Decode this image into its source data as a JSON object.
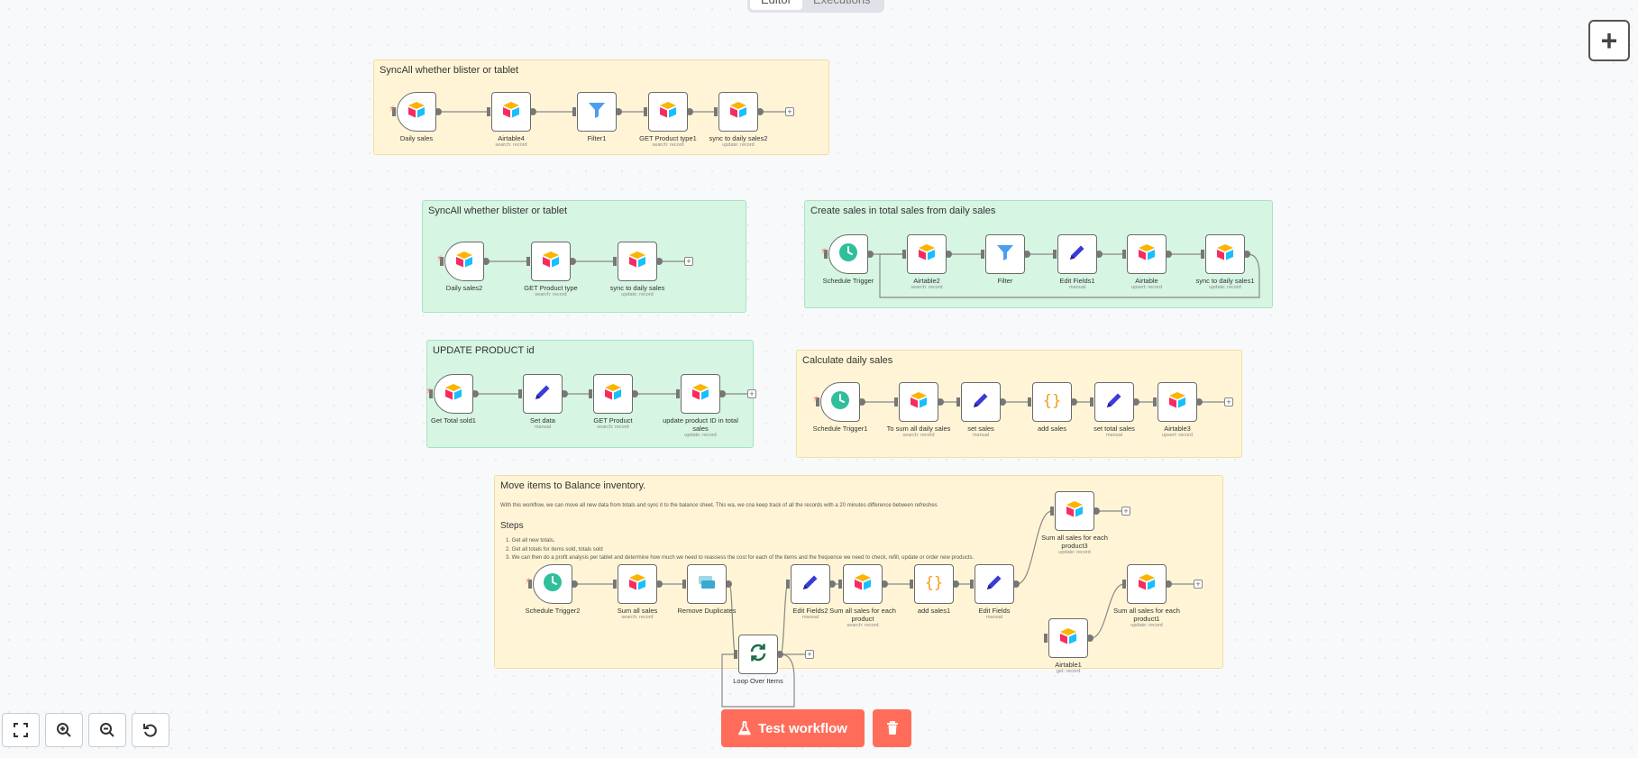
{
  "header": {
    "tabs": [
      {
        "label": "Editor",
        "active": true
      },
      {
        "label": "Executions",
        "active": false
      }
    ]
  },
  "canvas_controls": {
    "add_node_label": "+"
  },
  "stickies": [
    {
      "id": "s1",
      "color": "yellow",
      "title": "SyncAll whether blister or tablet"
    },
    {
      "id": "s2",
      "color": "green",
      "title": "SyncAll whether blister or tablet"
    },
    {
      "id": "s3",
      "color": "green",
      "title": "Create sales in total sales from daily sales"
    },
    {
      "id": "s4",
      "color": "green",
      "title": "UPDATE PRODUCT id"
    },
    {
      "id": "s5",
      "color": "yellow",
      "title": "Calculate daily sales"
    },
    {
      "id": "s6",
      "color": "yellow",
      "title": "Move items to Balance inventory.",
      "description": "With this workflow, we can move all new data from totals and sync it to the balance sheet. This wa, we cna keep track of all the records with a 20 minutes difference between refreshes",
      "steps_heading": "Steps",
      "steps": [
        "1. Get all new totals,",
        "2. Get all totals for items sold, totals sold",
        "3. We can then do a profit analysis per tablet and determine how much we need to reassess the cost for each of the items and the frequence we need to check, refill, update or order new products."
      ]
    }
  ],
  "nodes": [
    {
      "id": "n1",
      "label": "Daily sales",
      "subtitle": "",
      "icon": "airtable-icon"
    },
    {
      "id": "n2",
      "label": "Airtable4",
      "subtitle": "search: record",
      "icon": "airtable-icon"
    },
    {
      "id": "n3",
      "label": "Filter1",
      "subtitle": "",
      "icon": "filter-icon"
    },
    {
      "id": "n4",
      "label": "GET Product type1",
      "subtitle": "search: record",
      "icon": "airtable-icon"
    },
    {
      "id": "n5",
      "label": "sync to daily sales2",
      "subtitle": "update: record",
      "icon": "airtable-icon"
    },
    {
      "id": "n6",
      "label": "Daily sales2",
      "subtitle": "",
      "icon": "airtable-icon"
    },
    {
      "id": "n7",
      "label": "GET Product type",
      "subtitle": "search: record",
      "icon": "airtable-icon"
    },
    {
      "id": "n8",
      "label": "sync to daily sales",
      "subtitle": "update: record",
      "icon": "airtable-icon"
    },
    {
      "id": "n9",
      "label": "Schedule Trigger",
      "subtitle": "",
      "icon": "clock-icon"
    },
    {
      "id": "n10",
      "label": "Airtable2",
      "subtitle": "search: record",
      "icon": "airtable-icon"
    },
    {
      "id": "n11",
      "label": "Filter",
      "subtitle": "",
      "icon": "filter-icon"
    },
    {
      "id": "n12",
      "label": "Edit Fields1",
      "subtitle": "manual",
      "icon": "pencil-icon"
    },
    {
      "id": "n13",
      "label": "Airtable",
      "subtitle": "upsert: record",
      "icon": "airtable-icon"
    },
    {
      "id": "n14",
      "label": "sync to daily sales1",
      "subtitle": "update: record",
      "icon": "airtable-icon"
    },
    {
      "id": "n15",
      "label": "Get Total sold1",
      "subtitle": "",
      "icon": "airtable-icon"
    },
    {
      "id": "n16",
      "label": "Set data",
      "subtitle": "manual",
      "icon": "pencil-icon"
    },
    {
      "id": "n17",
      "label": "GET Product",
      "subtitle": "search: record",
      "icon": "airtable-icon"
    },
    {
      "id": "n18",
      "label": "update product ID in total sales",
      "subtitle": "update: record",
      "icon": "airtable-icon"
    },
    {
      "id": "n19",
      "label": "Schedule Trigger1",
      "subtitle": "",
      "icon": "clock-icon"
    },
    {
      "id": "n20",
      "label": "To sum all daily sales",
      "subtitle": "search: record",
      "icon": "airtable-icon"
    },
    {
      "id": "n21",
      "label": "set sales",
      "subtitle": "manual",
      "icon": "pencil-icon"
    },
    {
      "id": "n22",
      "label": "add sales",
      "subtitle": "",
      "icon": "code-icon"
    },
    {
      "id": "n23",
      "label": "set total sales",
      "subtitle": "manual",
      "icon": "pencil-icon"
    },
    {
      "id": "n24",
      "label": "Airtable3",
      "subtitle": "upsert: record",
      "icon": "airtable-icon"
    },
    {
      "id": "n25",
      "label": "Schedule Trigger2",
      "subtitle": "",
      "icon": "clock-icon"
    },
    {
      "id": "n26",
      "label": "Sum all sales",
      "subtitle": "search: record",
      "icon": "airtable-icon"
    },
    {
      "id": "n27",
      "label": "Remove Duplicates",
      "subtitle": "",
      "icon": "remove-duplicates-icon"
    },
    {
      "id": "n28",
      "label": "Loop Over Items",
      "subtitle": "",
      "icon": "loop-icon"
    },
    {
      "id": "n29",
      "label": "Edit Fields2",
      "subtitle": "manual",
      "icon": "pencil-icon"
    },
    {
      "id": "n30",
      "label": "Sum all sales for each product",
      "subtitle": "search: record",
      "icon": "airtable-icon"
    },
    {
      "id": "n31",
      "label": "add sales1",
      "subtitle": "",
      "icon": "code-icon"
    },
    {
      "id": "n32",
      "label": "Edit Fields",
      "subtitle": "manual",
      "icon": "pencil-icon"
    },
    {
      "id": "n33",
      "label": "Sum all sales for each product3",
      "subtitle": "update: record",
      "icon": "airtable-icon"
    },
    {
      "id": "n34",
      "label": "Sum all sales for each product1",
      "subtitle": "update: record",
      "icon": "airtable-icon"
    },
    {
      "id": "n35",
      "label": "Airtable1",
      "subtitle": "get: record",
      "icon": "airtable-icon"
    }
  ],
  "footer": {
    "test_workflow_label": "Test workflow"
  },
  "colors": {
    "accent": "#ff6d5a",
    "sticky_yellow": "#fff5d6",
    "sticky_green": "#d6f5e3",
    "clock": "#2fbf9a",
    "pencil": "#3b3bd8",
    "filter": "#4a9df0",
    "code": "#f59a23"
  }
}
